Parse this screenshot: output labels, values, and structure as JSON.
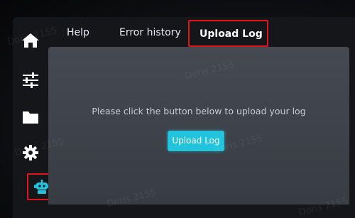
{
  "tabs": [
    {
      "label": "Help",
      "selected": false
    },
    {
      "label": "Error history",
      "selected": false
    },
    {
      "label": "Upload Log",
      "selected": true
    }
  ],
  "sidebar": {
    "items": [
      {
        "icon": "home-icon",
        "active": false
      },
      {
        "icon": "sliders-icon",
        "active": false
      },
      {
        "icon": "folder-icon",
        "active": false
      },
      {
        "icon": "gear-icon",
        "active": false
      },
      {
        "icon": "robot-icon",
        "active": true
      }
    ]
  },
  "main": {
    "message": "Please click the button below to upload your log",
    "upload_button_label": "Upload Log"
  },
  "watermark": "Doris 2155",
  "colors": {
    "accent": "#22c3dc",
    "highlight_border": "#e0161b",
    "panel": "#42464e"
  }
}
